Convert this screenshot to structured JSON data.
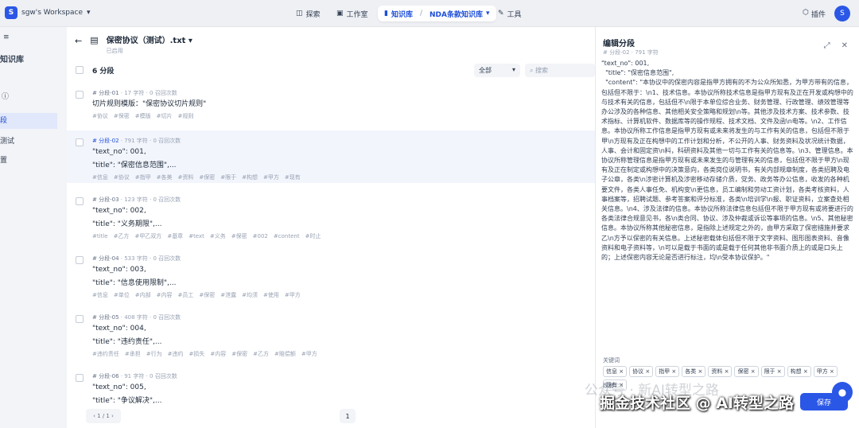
{
  "topbar": {
    "workspace_initial": "S",
    "workspace_name": "sgw's Workspace",
    "nav": {
      "explore": "探索",
      "studio": "工作室",
      "knowledge": "知识库",
      "current_kb": "NDA条款知识库",
      "tools": "工具"
    },
    "plugins": "插件",
    "avatar": "S"
  },
  "sidebar": {
    "title": "知识库",
    "items": [
      "",
      "",
      "段",
      "测试",
      "置"
    ]
  },
  "document": {
    "name": "保密协议（测试）.txt",
    "status": "已启用"
  },
  "list": {
    "count": "6 分段",
    "filter": "全部",
    "search_placeholder": "搜索",
    "chunks": [
      {
        "id": "# 分段-01",
        "chars": "17 字符",
        "hits": "0 召回次数",
        "lines": [
          "切片规则模版：\"保密协议切片规则\""
        ],
        "tags": [
          "协议",
          "保密",
          "模版",
          "切片",
          "规则"
        ]
      },
      {
        "id": "# 分段-02",
        "chars": "791 字符",
        "hits": "0 召回次数",
        "lines": [
          "\"text_no\": 001,",
          "\"title\": \"保密信息范围\",..."
        ],
        "tags": [
          "信息",
          "协议",
          "指甲",
          "各美",
          "资料",
          "保密",
          "限于",
          "构想",
          "甲方",
          "现有"
        ]
      },
      {
        "id": "# 分段-03",
        "chars": "123 字符",
        "hits": "0 召回次数",
        "lines": [
          "\"text_no\": 002,",
          "\"title\": \"义务期限\",..."
        ],
        "tags": [
          "title",
          "乙方",
          "甲乙双方",
          "基章",
          "text",
          "义务",
          "保密",
          "002",
          "content",
          "时止"
        ]
      },
      {
        "id": "# 分段-04",
        "chars": "533 字符",
        "hits": "0 召回次数",
        "lines": [
          "\"text_no\": 003,",
          "\"title\": \"信息使用限制\",..."
        ],
        "tags": [
          "信息",
          "单位",
          "内部",
          "内容",
          "员工",
          "保密",
          "泄露",
          "均须",
          "使用",
          "甲方"
        ]
      },
      {
        "id": "# 分段-05",
        "chars": "408 字符",
        "hits": "0 召回次数",
        "lines": [
          "\"text_no\": 004,",
          "\"title\": \"违约责任\",..."
        ],
        "tags": [
          "违约责任",
          "承担",
          "行为",
          "违约",
          "损失",
          "内容",
          "保密",
          "乙方",
          "赔偿额",
          "甲方"
        ]
      },
      {
        "id": "# 分段-06",
        "chars": "91 字符",
        "hits": "0 召回次数",
        "lines": [
          "\"text_no\": 005,",
          "\"title\": \"争议解决\",..."
        ],
        "tags": []
      }
    ],
    "pager": "1 / 1",
    "page": "1"
  },
  "editor": {
    "title": "编辑分段",
    "meta": "# 分段-02 · 791 字符",
    "content": "\"text_no\": 001,\n  \"title\": \"保密信息范围\",\n  \"content\": \"本协议中的保密内容是指甲方拥有的不为公众所知悉，为甲方带有的信息，包括但不限于：\\n1、技术信息。本协议所称技术信息是指甲方现有及正在开发或构想中的与技术有关的信息，包括但不\\n限于本单位综合业务、财务管理、行政管理、绩效管理等办公涉及的各种信息、其他相关安全策略和规划\\n等。其他涉及技术方案、技术参数、技术指标、计算机软件、数据库等的操作规程、技术文档、文件及函\\n电等。\\n2、工作信息。本协议所称工作信息是指甲方现有或未来将发生的与工作有关的信息，包括但不限于甲\\n方现有及正在构想中的工作计划和分析，不公开的人事、财务资料及状况统计数据，人事、会计和固定资\\n料，科研资料及其他一切与工作有关的信息等。\\n3、管理信息。本协议所称管理信息是指甲方现有或未来发生的与管理有关的信息，包括但不限于甲方\\n现有及正在制定或构想中的决策意向，各类岗位说明书，有关内部规章制度，各类招聘及电子公章，各类\\n涉密计算机及涉密移动存储介质，党务、政务等办公信息，收发的各种机要文件，各类人事任免、机构变\\n更信息，员工编制和劳动工资计划，各类考核资料，人事档案等，招聘试题、参考答案和评分标准，各类\\n培训学\\n报、职证资料，立案查处相关信息。\\n4、涉及法律的信息。本协议所称法律信息包括但不限于甲方现有或将要进行的各类法律合规意见书，各\\n类合同、协议、涉及仲裁或诉讼等事项的信息。\\n5、其他秘密信息。本协议所称其他秘密信息，是指除上述规定之外的，由甲方采取了保密措施并要求乙\\n方予以保密的有关信息。上述秘密载体包括但不限于文字资料、图形图表资料、音像资料和电子资料等，\\n可以是载于书面的或是载于任何其他非书面介质上的或是口头上的；上述保密内容无论是否进行标注，均\\n受本协议保护。\"",
    "keywords_label": "关键词",
    "keywords": [
      "信息",
      "协议",
      "指甲",
      "各类",
      "资料",
      "保密",
      "限于",
      "构想",
      "甲方",
      "现有"
    ],
    "questions_label": "现有",
    "save": "保存"
  },
  "watermark": {
    "line1": "公众号 · 新AI转型之路",
    "line2": "掘金技术社区 @ AI转型之路"
  }
}
